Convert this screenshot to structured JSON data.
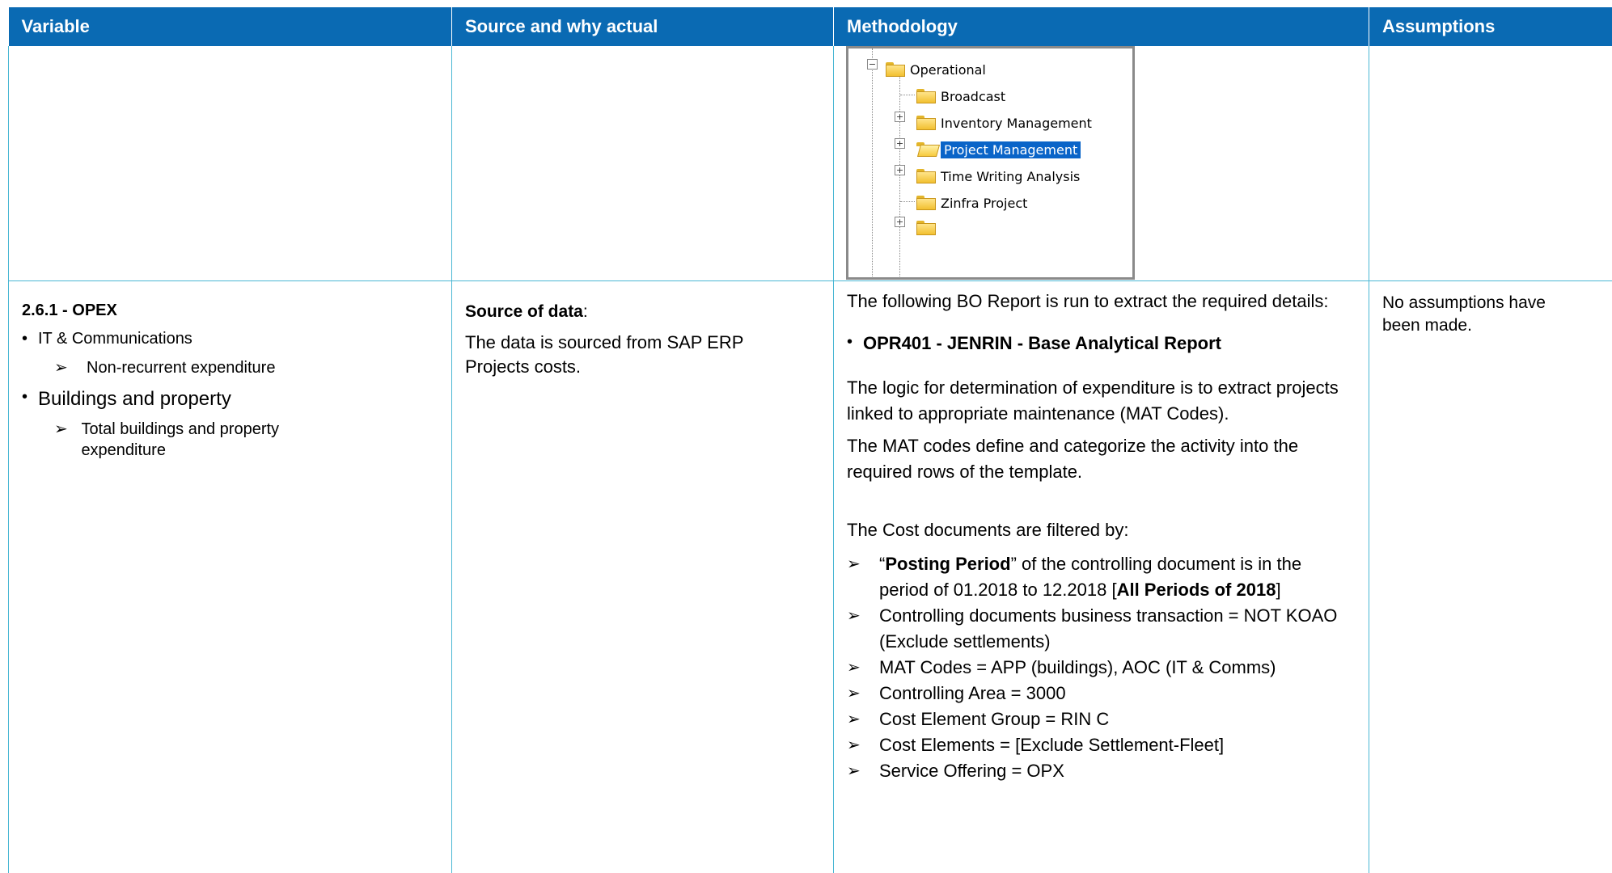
{
  "headers": [
    "Variable",
    "Source and why actual",
    "Methodology",
    "Assumptions"
  ],
  "tree": {
    "root": "Operational",
    "items": [
      "Broadcast",
      "Inventory Management",
      "Project Management",
      "Time Writing Analysis",
      "Zinfra Project"
    ],
    "selected": "Project Management"
  },
  "variable": {
    "title": "2.6.1 - OPEX",
    "bullet1": "IT & Communications",
    "sub1": "Non-recurrent expenditure",
    "bullet2": "Buildings and property",
    "sub2": "Total buildings and property expenditure"
  },
  "source": {
    "label": "Source of data",
    "colon": ":",
    "text": "The data is sourced from SAP ERP Projects costs."
  },
  "methodology": {
    "intro": "The following BO Report is run to extract the required details:",
    "report": "OPR401 - JENRIN - Base Analytical Report",
    "logic1": "The logic for determination of expenditure is to extract projects linked to appropriate maintenance (MAT Codes).",
    "logic2": "The MAT codes define and categorize the activity into the required rows of the template.",
    "filter_intro": "The Cost documents are filtered by:",
    "f1_open": "“",
    "f1_bold": "Posting Period",
    "f1_rest": "” of the controlling document is in the period of 01.2018 to 12.2018 [",
    "f1_bold2": "All Periods of 2018",
    "f1_close": "]",
    "filters": [
      "Controlling documents business transaction = NOT KOAO (Exclude settlements)",
      "MAT Codes = APP (buildings), AOC (IT & Comms)",
      "Controlling Area = 3000",
      "Cost Element Group = RIN C",
      "Cost Elements = [Exclude Settlement-Fleet]",
      "Service Offering = OPX"
    ]
  },
  "assumptions": {
    "text": "No assumptions have been made."
  },
  "colors": {
    "header_bg": "#0a6ab3",
    "border": "#4ab7d4",
    "selection": "#0a64c8"
  }
}
